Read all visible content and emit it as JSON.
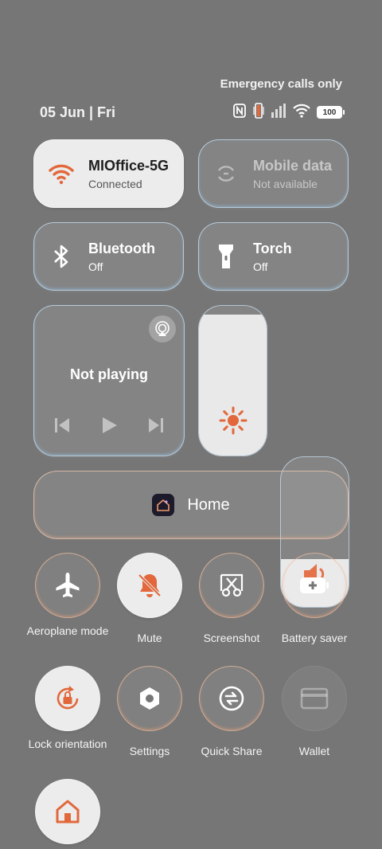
{
  "status": {
    "carrier": "Emergency calls only",
    "date": "05 Jun | Fri",
    "battery": "100"
  },
  "tiles": {
    "wifi": {
      "title": "MIOffice-5G",
      "sub": "Connected"
    },
    "mobile": {
      "title": "Mobile data",
      "sub": "Not available"
    },
    "bluetooth": {
      "title": "Bluetooth",
      "sub": "Off"
    },
    "torch": {
      "title": "Torch",
      "sub": "Off"
    }
  },
  "media": {
    "status": "Not playing"
  },
  "sliders": {
    "brightness_level": 0.94,
    "volume_level": 0.32
  },
  "home": {
    "label": "Home"
  },
  "toggles": [
    {
      "label": "Aeroplane mode",
      "state": "off",
      "icon": "airplane-icon"
    },
    {
      "label": "Mute",
      "state": "on",
      "icon": "bell-off-icon"
    },
    {
      "label": "Screenshot",
      "state": "off",
      "icon": "scissors-icon"
    },
    {
      "label": "Battery saver",
      "state": "off",
      "icon": "battery-plus-icon"
    },
    {
      "label": "Lock orientation",
      "state": "on",
      "icon": "rotation-lock-icon"
    },
    {
      "label": "Settings",
      "state": "off",
      "icon": "gear-icon"
    },
    {
      "label": "Quick Share",
      "state": "off",
      "icon": "quick-share-icon"
    },
    {
      "label": "Wallet",
      "state": "disabled",
      "icon": "wallet-icon"
    },
    {
      "label": "",
      "state": "on",
      "icon": "home-icon"
    }
  ],
  "colors": {
    "accent": "#e2683c",
    "background": "#767676",
    "tile_on": "#ececec"
  }
}
